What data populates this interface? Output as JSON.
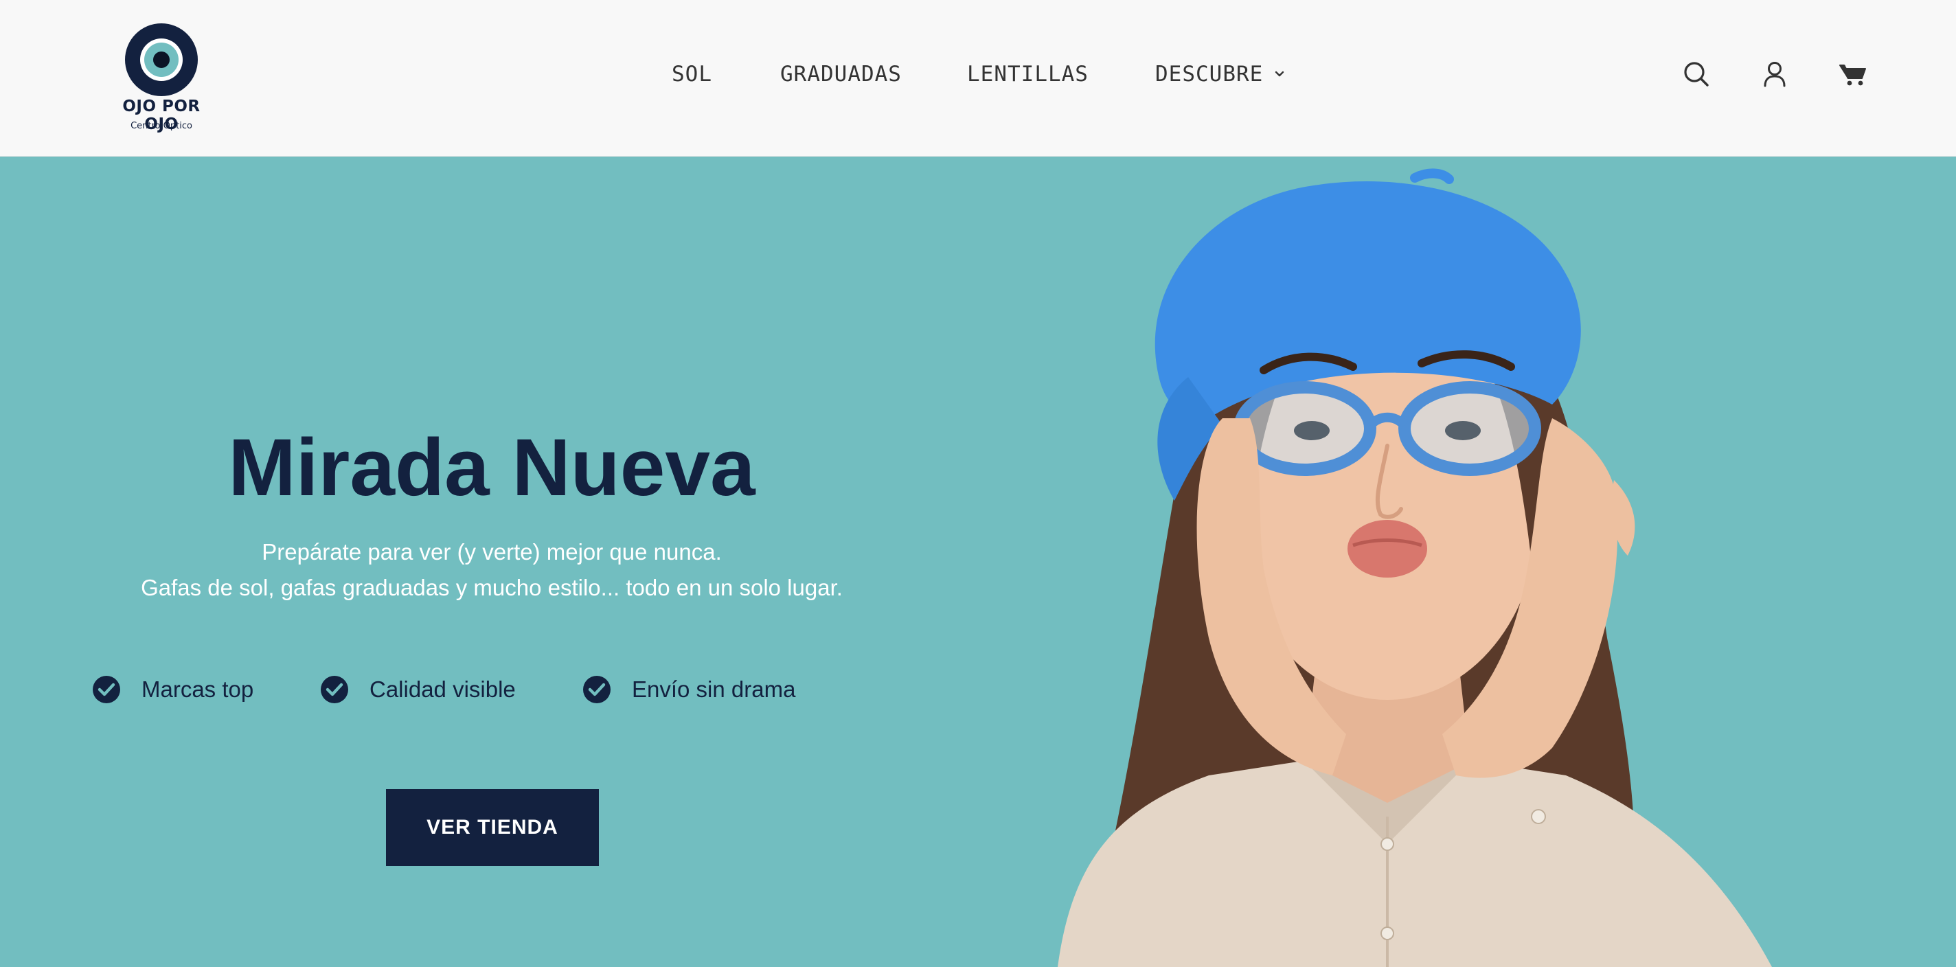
{
  "brand": {
    "name": "OJO POR OJO",
    "tagline": "Centro Óptico"
  },
  "nav": {
    "items": [
      {
        "label": "SOL"
      },
      {
        "label": "GRADUADAS"
      },
      {
        "label": "LENTILLAS"
      },
      {
        "label": "DESCUBRE"
      }
    ]
  },
  "header_icons": [
    "search-icon",
    "account-icon",
    "cart-icon"
  ],
  "hero": {
    "title": "Mirada Nueva",
    "subtitle_line1": "Prepárate para ver (y verte) mejor que nunca.",
    "subtitle_line2": "Gafas de sol, gafas graduadas y mucho estilo... todo en un solo lugar.",
    "features": [
      {
        "label": "Marcas top"
      },
      {
        "label": "Calidad visible"
      },
      {
        "label": "Envío sin drama"
      }
    ],
    "cta_label": "VER TIENDA"
  },
  "colors": {
    "header_bg": "#f8f8f8",
    "hero_bg": "#72bec0",
    "navy": "#13213f",
    "nav_text": "#333333",
    "beret_blue": "#3d8ee6"
  }
}
